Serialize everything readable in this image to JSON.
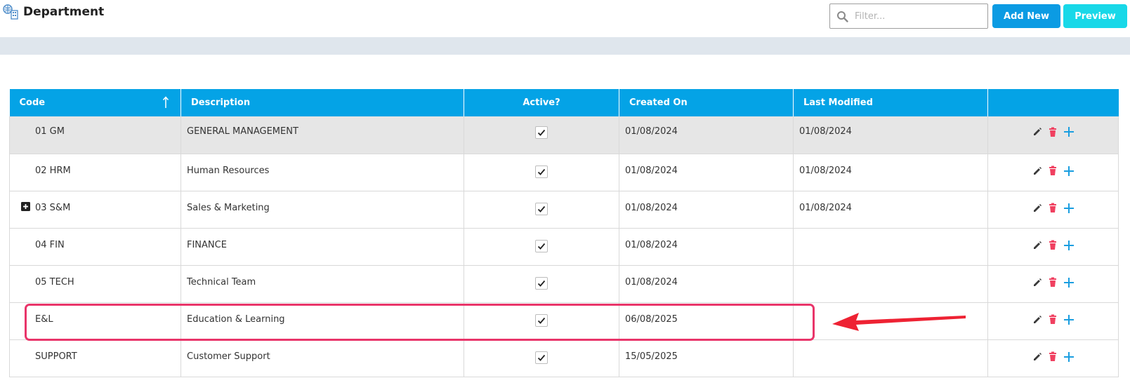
{
  "header": {
    "title": "Department",
    "filter_placeholder": "Filter...",
    "add_label": "Add New",
    "preview_label": "Preview"
  },
  "table": {
    "columns": [
      "Code",
      "Description",
      "Active?",
      "Created On",
      "Last Modified"
    ],
    "rows": [
      {
        "code": "01 GM",
        "description": "GENERAL MANAGEMENT",
        "active": true,
        "created": "01/08/2024",
        "modified": "01/08/2024"
      },
      {
        "code": "02 HRM",
        "description": "Human Resources",
        "active": true,
        "created": "01/08/2024",
        "modified": "01/08/2024"
      },
      {
        "code": "03 S&M",
        "description": "Sales & Marketing",
        "active": true,
        "created": "01/08/2024",
        "modified": "01/08/2024"
      },
      {
        "code": "04 FIN",
        "description": "FINANCE",
        "active": true,
        "created": "01/08/2024",
        "modified": ""
      },
      {
        "code": "05 TECH",
        "description": "Technical Team",
        "active": true,
        "created": "01/08/2024",
        "modified": ""
      },
      {
        "code": "E&L",
        "description": "Education & Learning",
        "active": true,
        "created": "06/08/2025",
        "modified": ""
      },
      {
        "code": "SUPPORT",
        "description": "Customer Support",
        "active": true,
        "created": "15/05/2025",
        "modified": ""
      }
    ]
  },
  "icons": {
    "edit": "pencil-icon",
    "delete": "trash-icon",
    "add": "plus-icon",
    "sort": "sort-ascending-icon",
    "expand": "expand-plus-icon",
    "search": "search-icon",
    "app": "department-icon"
  },
  "colors": {
    "header_bg": "#04a3e6",
    "add_button": "#0b9be3",
    "preview_button": "#18d8e8",
    "delete_icon": "#f04060",
    "add_icon": "#1a9ee0",
    "highlight": "#e9356a",
    "arrow": "#ee2233"
  }
}
